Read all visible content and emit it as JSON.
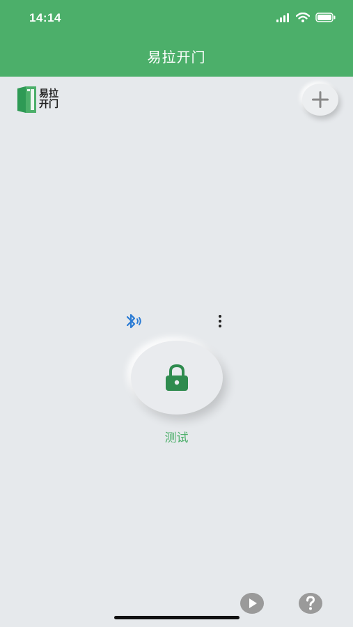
{
  "status_bar": {
    "time": "14:14"
  },
  "header": {
    "title": "易拉开门"
  },
  "logo": {
    "line1": "易拉",
    "line2": "开门"
  },
  "device": {
    "name": "测试"
  },
  "icons": {
    "add": "plus-icon",
    "bluetooth": "bluetooth-icon",
    "more": "more-vertical-icon",
    "lock": "lock-icon",
    "play": "play-icon",
    "help": "help-icon"
  },
  "colors": {
    "brand_green": "#4caf6a",
    "bluetooth_blue": "#2a7bd4",
    "lock_green": "#2e8b4e",
    "background": "#e6e9ec"
  }
}
